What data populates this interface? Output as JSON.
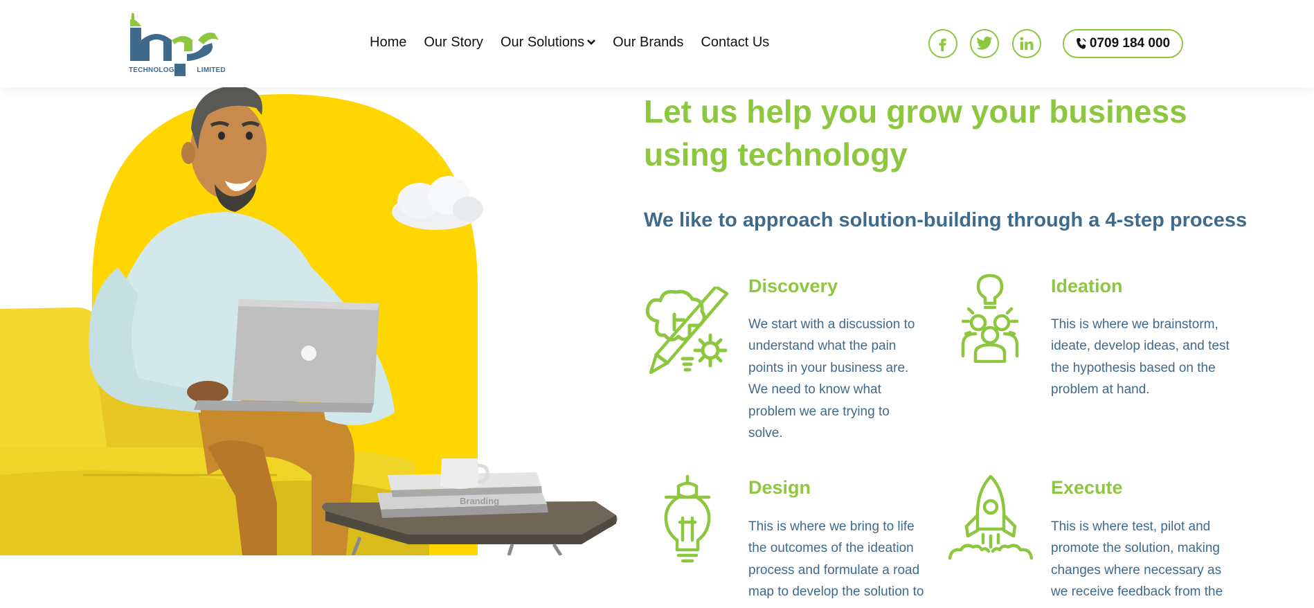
{
  "header": {
    "logo": {
      "wordmark": "mfs",
      "left_text": "TECHNOLOGIES",
      "right_text": "LIMITED"
    },
    "nav": [
      {
        "label": "Home"
      },
      {
        "label": "Our Story"
      },
      {
        "label": "Our Solutions",
        "has_dropdown": true
      },
      {
        "label": "Our Brands"
      },
      {
        "label": "Contact Us"
      }
    ],
    "social": [
      "facebook-icon",
      "twitter-icon",
      "linkedin-icon"
    ],
    "phone": "0709 184 000"
  },
  "hero": {
    "headline_line1": "Let us help you grow your business",
    "headline_line2": "using technology",
    "subheading": "We like to approach solution-building through a 4-step process",
    "book_text": "Branding"
  },
  "steps": [
    {
      "title": "Discovery",
      "icon": "brain-gear-icon",
      "lines": [
        "We start with a discussion to",
        "understand what the pain",
        "points in your business are.",
        "We need to know what",
        "problem we are trying to",
        "solve."
      ]
    },
    {
      "title": "Ideation",
      "icon": "bulb-team-icon",
      "lines": [
        "This is where we brainstorm,",
        "ideate, develop ideas, and test",
        "the hypothesis based on the",
        "problem at hand."
      ]
    },
    {
      "title": "Design",
      "icon": "bulb-design-icon",
      "lines": [
        "This is where we bring to life",
        "the outcomes of the ideation",
        "process and formulate a road",
        "map to develop the solution to"
      ]
    },
    {
      "title": "Execute",
      "icon": "rocket-icon",
      "lines": [
        "This is where test, pilot and",
        "promote the solution, making",
        "changes where necessary as",
        "we receive feedback from the"
      ]
    }
  ],
  "colors": {
    "accent_green": "#8dc63f",
    "brand_blue": "#3f6a8c",
    "hero_yellow": "#ffd600"
  }
}
